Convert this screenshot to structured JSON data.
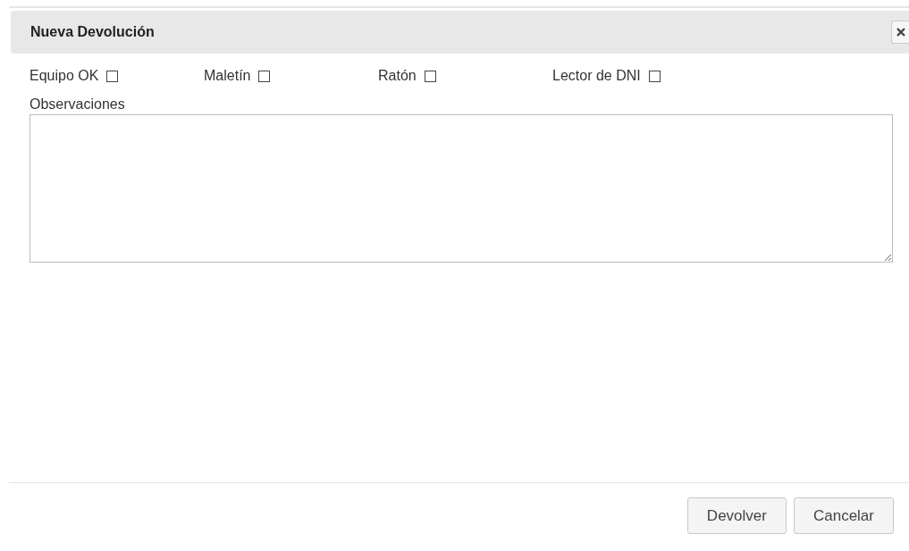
{
  "dialog": {
    "title": "Nueva Devolución"
  },
  "checks": [
    {
      "label": "Equipo OK",
      "checked": false
    },
    {
      "label": "Maletín",
      "checked": false
    },
    {
      "label": "Ratón",
      "checked": false
    },
    {
      "label": "Lector de DNI",
      "checked": false
    }
  ],
  "notes": {
    "label": "Observaciones"
  },
  "buttons": [
    {
      "label": "Devolver"
    },
    {
      "label": "Cancelar"
    }
  ]
}
